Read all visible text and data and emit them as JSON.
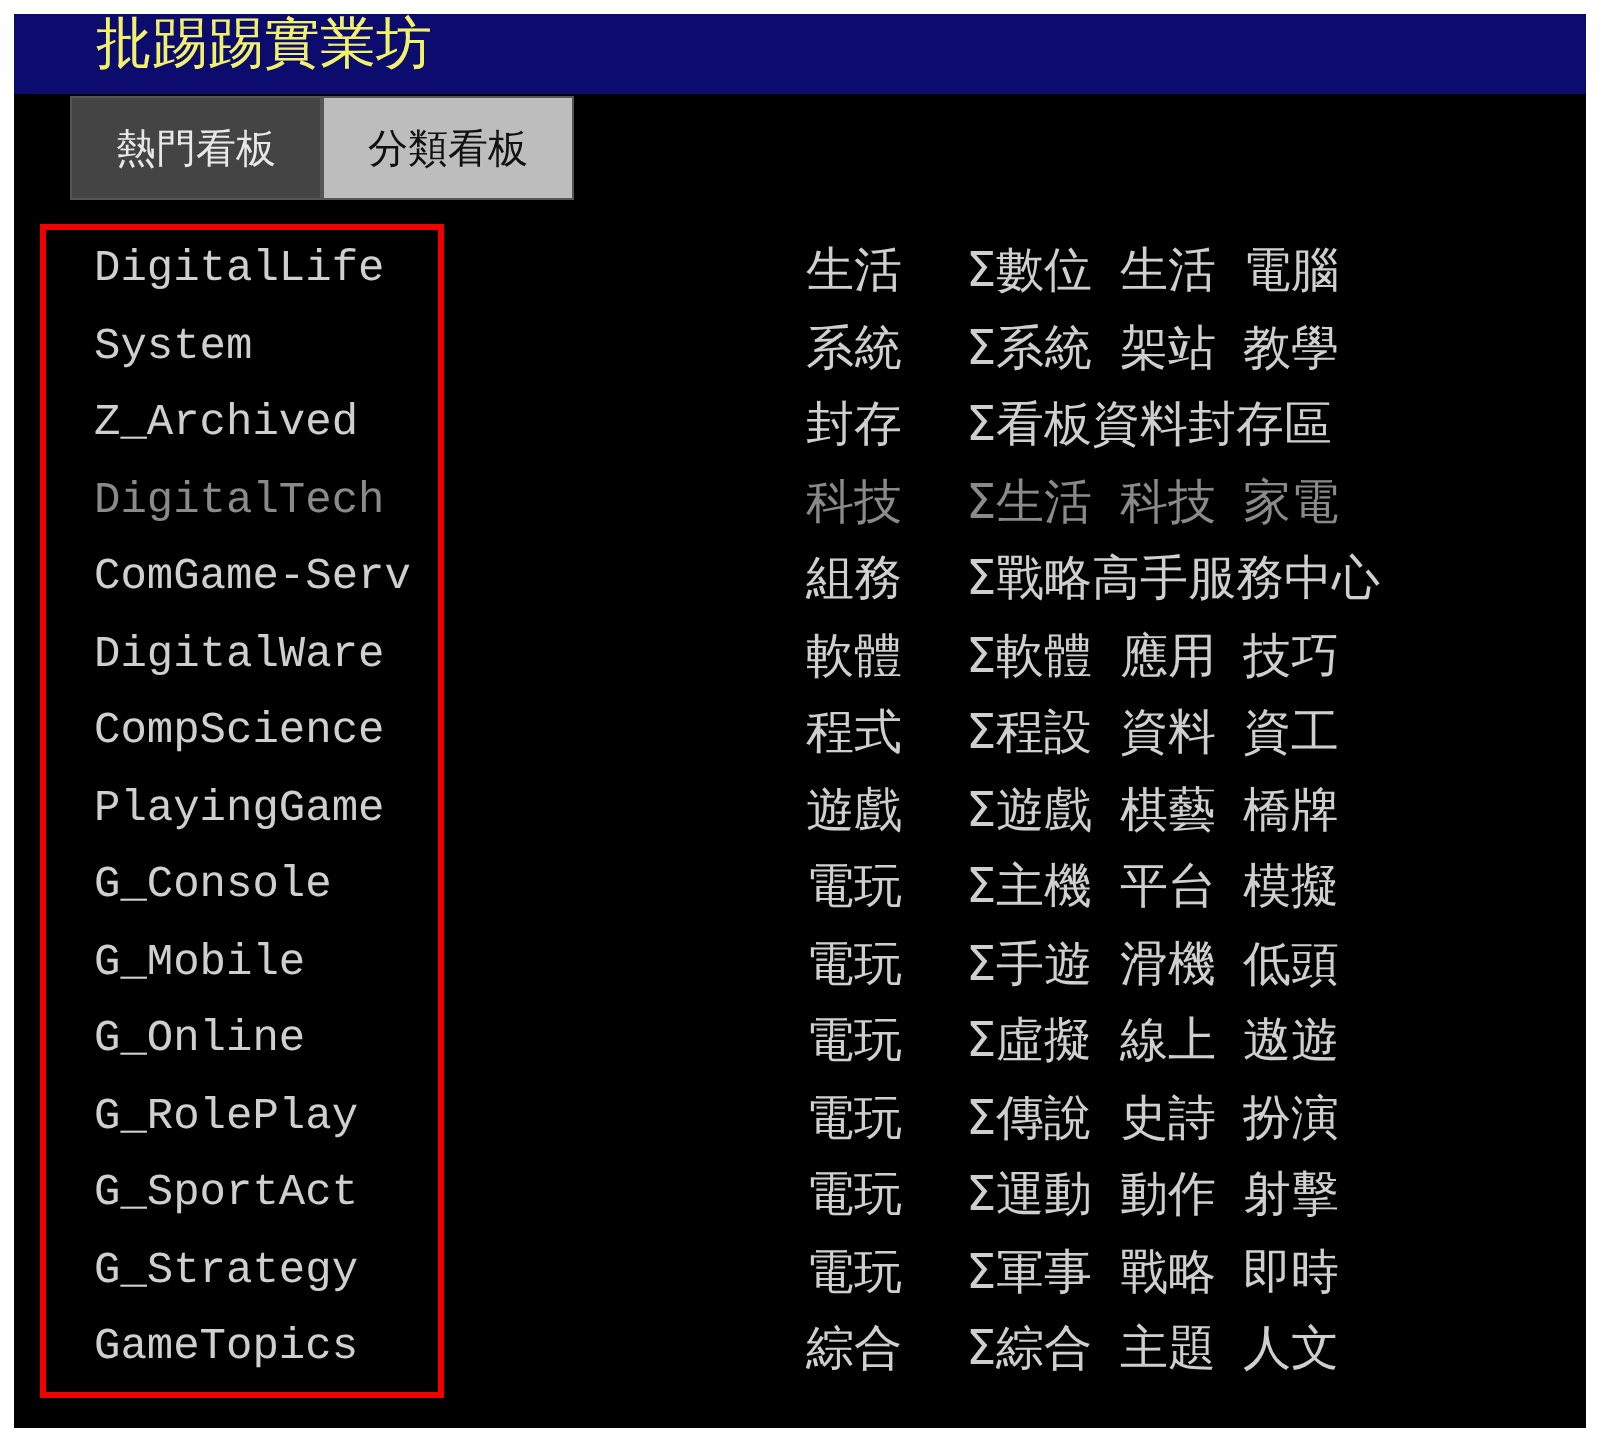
{
  "header": {
    "title": "批踢踢實業坊"
  },
  "tabs": [
    {
      "label": "熱門看板",
      "selected": false
    },
    {
      "label": "分類看板",
      "selected": true
    }
  ],
  "boards": [
    {
      "name": "DigitalLife",
      "class": "生活",
      "title": "Σ數位 生活 電腦",
      "dimmed": false
    },
    {
      "name": "System",
      "class": "系統",
      "title": "Σ系統 架站 教學",
      "dimmed": false
    },
    {
      "name": "Z_Archived",
      "class": "封存",
      "title": "Σ看板資料封存區",
      "dimmed": false
    },
    {
      "name": "DigitalTech",
      "class": "科技",
      "title": "Σ生活 科技 家電",
      "dimmed": true
    },
    {
      "name": "ComGame-Serv",
      "class": "組務",
      "title": "Σ戰略高手服務中心",
      "dimmed": false
    },
    {
      "name": "DigitalWare",
      "class": "軟體",
      "title": "Σ軟體 應用 技巧",
      "dimmed": false
    },
    {
      "name": "CompScience",
      "class": "程式",
      "title": "Σ程設 資料 資工",
      "dimmed": false
    },
    {
      "name": "PlayingGame",
      "class": "遊戲",
      "title": "Σ遊戲 棋藝 橋牌",
      "dimmed": false
    },
    {
      "name": "G_Console",
      "class": "電玩",
      "title": "Σ主機 平台 模擬",
      "dimmed": false
    },
    {
      "name": "G_Mobile",
      "class": "電玩",
      "title": "Σ手遊 滑機 低頭",
      "dimmed": false
    },
    {
      "name": "G_Online",
      "class": "電玩",
      "title": "Σ虛擬 線上 遨遊",
      "dimmed": false
    },
    {
      "name": "G_RolePlay",
      "class": "電玩",
      "title": "Σ傳說 史詩 扮演",
      "dimmed": false
    },
    {
      "name": "G_SportAct",
      "class": "電玩",
      "title": "Σ運動 動作 射擊",
      "dimmed": false
    },
    {
      "name": "G_Strategy",
      "class": "電玩",
      "title": "Σ軍事 戰略 即時",
      "dimmed": false
    },
    {
      "name": "GameTopics",
      "class": "綜合",
      "title": "Σ綜合 主題 人文",
      "dimmed": false
    }
  ]
}
